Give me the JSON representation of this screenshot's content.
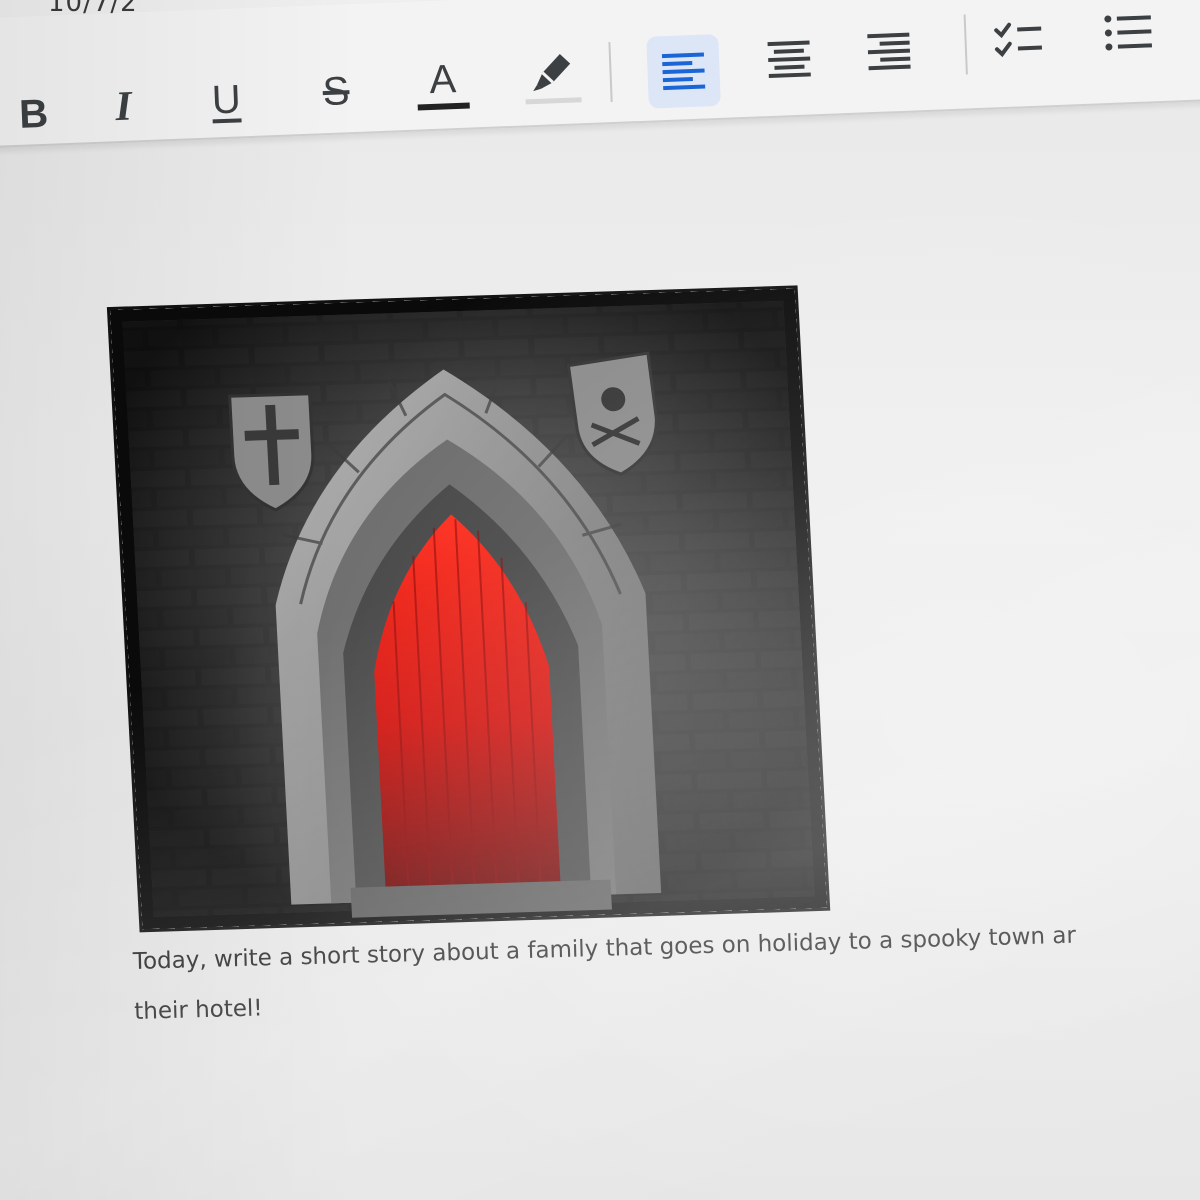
{
  "top_strip": {
    "partial_text": "10/7/2"
  },
  "toolbar": {
    "bold_label": "B",
    "italic_label": "I",
    "underline_label": "U",
    "strikethrough_label": "S",
    "text_color_label": "A",
    "icons": {
      "highlight": "highlighter-pen-icon",
      "align_left": "align-left-icon",
      "align_center": "align-center-icon",
      "align_right": "align-right-icon",
      "checklist": "checklist-icon",
      "bulleted_list": "bulleted-list-icon"
    },
    "active_alignment": "left",
    "active_color": "#1a66d6",
    "active_bg": "#dde6f7"
  },
  "document": {
    "image_subject": "Gothic stone archway with a red door",
    "caption_lines": [
      "Today, write a short story about a family that goes on holiday to a spooky town ar",
      "their hotel!"
    ]
  }
}
